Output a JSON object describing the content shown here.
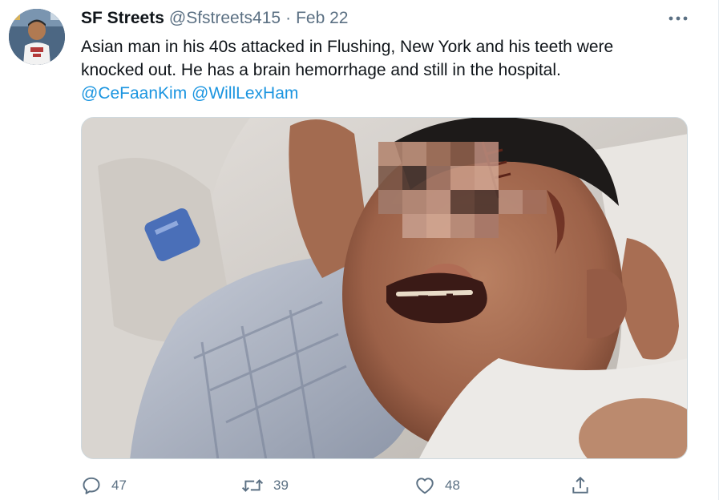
{
  "tweet": {
    "author_name": "SF Streets",
    "author_handle": "@Sfstreets415",
    "separator": "·",
    "date": "Feb 22",
    "text_line1": "Asian man in his 40s attacked in Flushing, New York and his teeth were",
    "text_line2": "knocked out. He has a brain hemorrhage and still in the hospital.",
    "mentions": [
      "@CeFaanKim",
      "@WillLexHam"
    ]
  },
  "actions": {
    "reply_count": "47",
    "retweet_count": "39",
    "like_count": "48"
  },
  "icons": {
    "more": "more-horizontal-icon",
    "reply": "reply-icon",
    "retweet": "retweet-icon",
    "like": "heart-icon",
    "share": "share-icon"
  },
  "colors": {
    "text": "#0f1419",
    "secondary": "#5b7083",
    "link": "#1b95e0"
  }
}
